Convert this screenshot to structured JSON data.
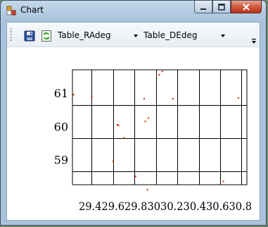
{
  "window": {
    "title": "Chart"
  },
  "toolbar": {
    "save_icon": "floppy-disk-icon",
    "refresh_icon": "refresh-icon",
    "x_combo_value": "Table_RAdeg",
    "y_combo_value": "Table_DEdeg"
  },
  "colors": {
    "point": "#cc2200",
    "grid": "#000000",
    "titlebar": "#b9cfe4",
    "close_button": "#c94a30"
  },
  "chart_data": {
    "type": "scatter",
    "title": "",
    "xlabel": "",
    "ylabel": "",
    "x_ticks": [
      29.4,
      29.6,
      29.8,
      30,
      30.2,
      30.4,
      30.6,
      30.8
    ],
    "x_tick_labels": [
      "29.4",
      "29.6",
      "29.8",
      "30",
      "30.2",
      "30.4",
      "30.6",
      "30.8"
    ],
    "y_ticks": [
      59,
      60,
      61
    ],
    "y_tick_labels": [
      "59",
      "60",
      "61"
    ],
    "xlim": [
      29.22,
      30.85
    ],
    "ylim": [
      58.6,
      62.05
    ],
    "grid": true,
    "legend": "none",
    "series": [
      {
        "x": [
          29.23,
          29.4,
          29.6,
          29.64,
          29.7,
          29.81,
          29.89,
          29.9,
          29.92,
          30.03,
          30.06,
          30.16,
          30.63,
          30.77,
          29.93,
          29.65
        ],
        "y": [
          61.3,
          61.25,
          59.3,
          60.4,
          60.0,
          58.85,
          61.18,
          60.5,
          58.45,
          61.9,
          62.0,
          61.18,
          58.7,
          61.2,
          60.6,
          60.38
        ]
      }
    ]
  }
}
